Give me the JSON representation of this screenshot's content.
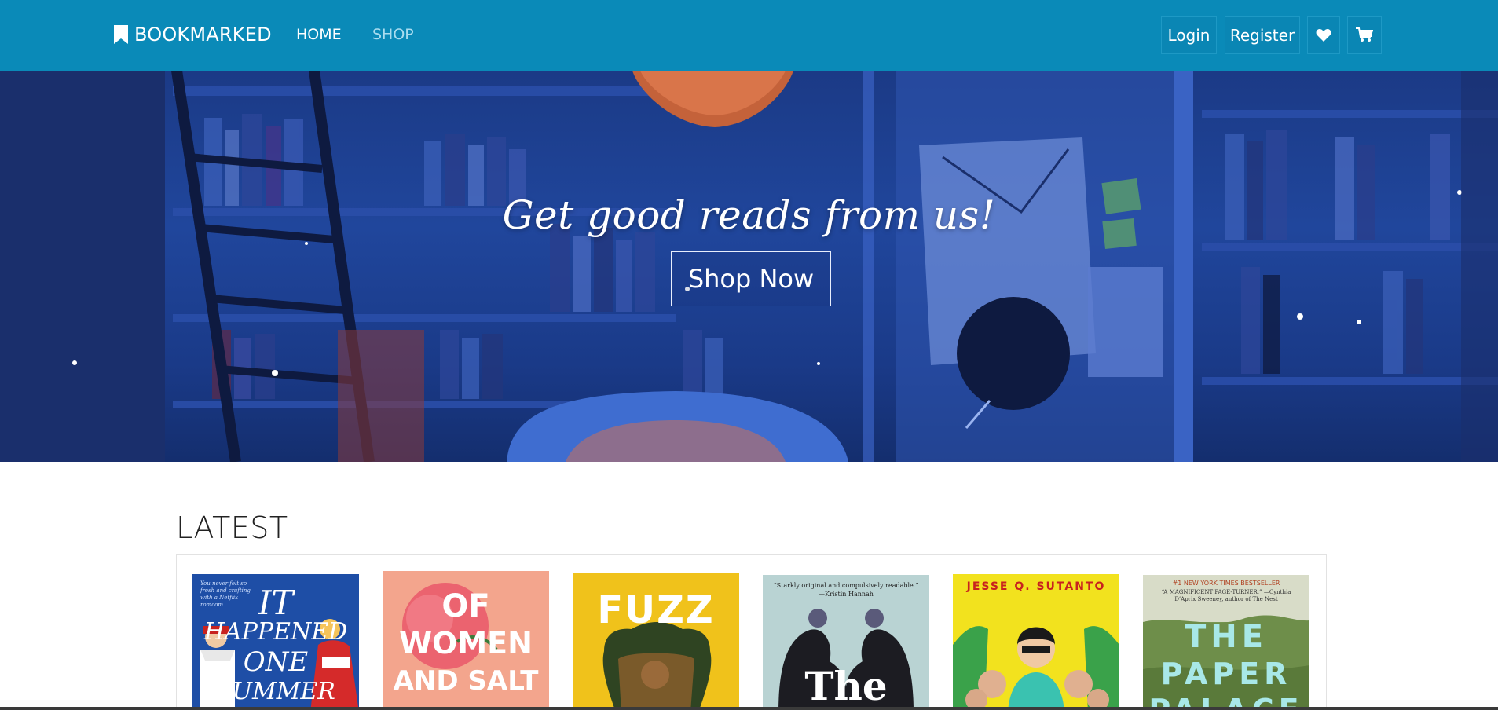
{
  "navbar": {
    "brand": "BOOKMARKED",
    "links": [
      {
        "label": "HOME"
      },
      {
        "label": "SHOP"
      }
    ],
    "login_label": "Login",
    "register_label": "Register",
    "icons": [
      "bookmark-icon",
      "heart-icon",
      "cart-icon"
    ]
  },
  "hero": {
    "title": "Get good reads from us!",
    "cta_label": "Shop Now"
  },
  "latest": {
    "heading": "LATEST",
    "books": [
      {
        "title_lines": [
          "IT",
          "HAPPENED",
          "ONE",
          "SUMMER"
        ],
        "blurb": "You never felt so fresh and crafting with a Netflix romcom",
        "color": "#1e4ea6"
      },
      {
        "title_lines": [
          "OF",
          "WOMEN",
          "AND SALT"
        ],
        "color": "#f3a58d"
      },
      {
        "title_lines": [
          "FUZZ"
        ],
        "color": "#f0c21b"
      },
      {
        "title_lines": [
          "The"
        ],
        "blurb": "“Starkly original and compulsively readable.” —Kristin Hannah",
        "color": "#b9d3d3"
      },
      {
        "title_lines": [
          "JESSE Q. SUTANTO"
        ],
        "color": "#f2e21e"
      },
      {
        "title_lines": [
          "#1 NEW YORK TIMES BESTSELLER",
          "THE",
          "PAPER",
          "PALACE"
        ],
        "blurb": "“A MAGNIFICENT PAGE-TURNER.” —Cynthia D’Aprix Sweeney, author of The Nest",
        "color": "#7a9a55"
      }
    ]
  },
  "colors": {
    "navbar": "#0a8ab8",
    "hero": "#20469c"
  }
}
